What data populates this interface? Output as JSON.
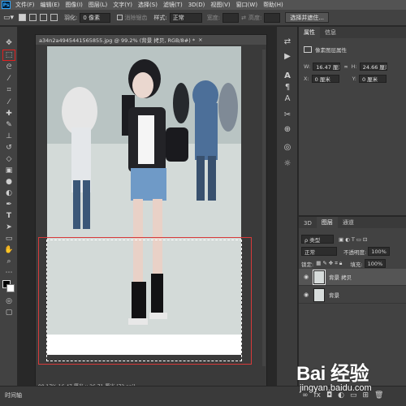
{
  "app": {
    "logo": "Ps"
  },
  "menubar": {
    "items": [
      "文件(F)",
      "编辑(E)",
      "图像(I)",
      "图层(L)",
      "文字(Y)",
      "选择(S)",
      "滤镜(T)",
      "3D(D)",
      "视图(V)",
      "窗口(W)",
      "帮助(H)"
    ]
  },
  "options": {
    "feather_label": "羽化:",
    "feather_value": "0 像素",
    "antialias_label": "消除锯齿",
    "style_label": "样式:",
    "style_value": "正常",
    "width_label": "宽度:",
    "height_label": "高度:",
    "select_mask_button": "选择并遮住..."
  },
  "document": {
    "tab_title": "a34n2a4945441565855.jpg @ 99.2% (背景 拷贝, RGB/8#) *",
    "status": "99.17%   16.47 厘米 x 26.71 厘米 (72 ppi)"
  },
  "properties": {
    "tabs": [
      "属性",
      "信息"
    ],
    "section_title": "像素图层属性",
    "w_label": "W:",
    "w_value": "16.47 厘米",
    "h_label": "H:",
    "h_value": "24.66 厘米",
    "x_label": "X:",
    "x_value": "0 厘米",
    "y_label": "Y:",
    "y_value": "0 厘米"
  },
  "layers": {
    "tabs": [
      "3D",
      "图层",
      "通道"
    ],
    "kind_filter": "ρ 类型",
    "blend_mode": "正常",
    "opacity_label": "不透明度:",
    "opacity_value": "100%",
    "lock_label": "锁定:",
    "fill_label": "填充:",
    "fill_value": "100%",
    "items": [
      {
        "name": "背景 拷贝",
        "selected": true
      },
      {
        "name": "背景",
        "selected": false
      }
    ]
  },
  "bottom": {
    "timeline_tab": "时间轴"
  },
  "watermark": {
    "logo": "Bai 经验",
    "url": "jingyan.baidu.com"
  },
  "colors": {
    "selection_highlight": "#d83a3a",
    "toolbar_highlight": "#e02020"
  }
}
